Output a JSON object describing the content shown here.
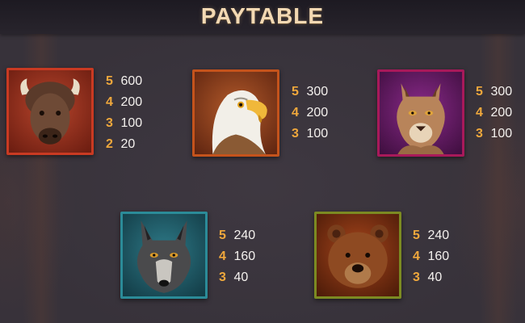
{
  "title": "PAYTABLE",
  "colors": {
    "accent": "#f0a83c",
    "value_text": "#f4f1ee",
    "title_text": "#f3d9b3",
    "background": "#37323a"
  },
  "symbols": [
    {
      "name": "bison",
      "frame_color": "#c93a22",
      "pays": [
        {
          "count": "5",
          "value": "600"
        },
        {
          "count": "4",
          "value": "200"
        },
        {
          "count": "3",
          "value": "100"
        },
        {
          "count": "2",
          "value": "20"
        }
      ]
    },
    {
      "name": "eagle",
      "frame_color": "#c4531c",
      "pays": [
        {
          "count": "5",
          "value": "300"
        },
        {
          "count": "4",
          "value": "200"
        },
        {
          "count": "3",
          "value": "100"
        }
      ]
    },
    {
      "name": "cougar",
      "frame_color": "#a8195a",
      "pays": [
        {
          "count": "5",
          "value": "300"
        },
        {
          "count": "4",
          "value": "200"
        },
        {
          "count": "3",
          "value": "100"
        }
      ]
    },
    {
      "name": "wolf",
      "frame_color": "#2b8b98",
      "pays": [
        {
          "count": "5",
          "value": "240"
        },
        {
          "count": "4",
          "value": "160"
        },
        {
          "count": "3",
          "value": "40"
        }
      ]
    },
    {
      "name": "bear",
      "frame_color": "#7c8a22",
      "pays": [
        {
          "count": "5",
          "value": "240"
        },
        {
          "count": "4",
          "value": "160"
        },
        {
          "count": "3",
          "value": "40"
        }
      ]
    }
  ]
}
